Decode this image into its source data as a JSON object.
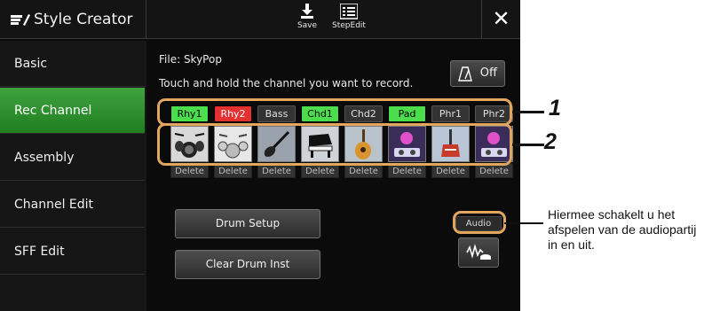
{
  "header": {
    "title": "Style Creator",
    "save_label": "Save",
    "stepedit_label": "StepEdit",
    "close_symbol": "✕"
  },
  "sidebar": {
    "items": [
      {
        "label": "Basic",
        "active": false
      },
      {
        "label": "Rec Channel",
        "active": true
      },
      {
        "label": "Assembly",
        "active": false
      },
      {
        "label": "Channel Edit",
        "active": false
      },
      {
        "label": "SFF Edit",
        "active": false
      }
    ]
  },
  "main": {
    "file_label": "File: SkyPop",
    "instruction": "Touch and hold the channel you want to record.",
    "metronome_label": "Off",
    "channels": [
      {
        "label": "Rhy1",
        "state": "green"
      },
      {
        "label": "Rhy2",
        "state": "red"
      },
      {
        "label": "Bass",
        "state": "gray"
      },
      {
        "label": "Chd1",
        "state": "green"
      },
      {
        "label": "Chd2",
        "state": "gray"
      },
      {
        "label": "Pad",
        "state": "green"
      },
      {
        "label": "Phr1",
        "state": "gray"
      },
      {
        "label": "Phr2",
        "state": "gray"
      }
    ],
    "voice_icons": [
      "drum-kit-icon",
      "drum-kit-icon",
      "bass-guitar-icon",
      "piano-icon",
      "acoustic-guitar-icon",
      "dj-icon",
      "electric-guitar-icon",
      "dj-icon"
    ],
    "delete_label": "Delete",
    "drum_setup_label": "Drum Setup",
    "clear_drum_label": "Clear Drum Inst",
    "audio_label": "Audio"
  },
  "annotations": {
    "callout_1": "1",
    "callout_2": "2",
    "note": "Hiermee schakelt u het afspelen van de audiopartij in en uit."
  },
  "colors": {
    "active_green": "#2f9a2f",
    "channel_green": "#4cdd4c",
    "channel_red": "#e53030",
    "callout_orange": "#e2a65e"
  }
}
